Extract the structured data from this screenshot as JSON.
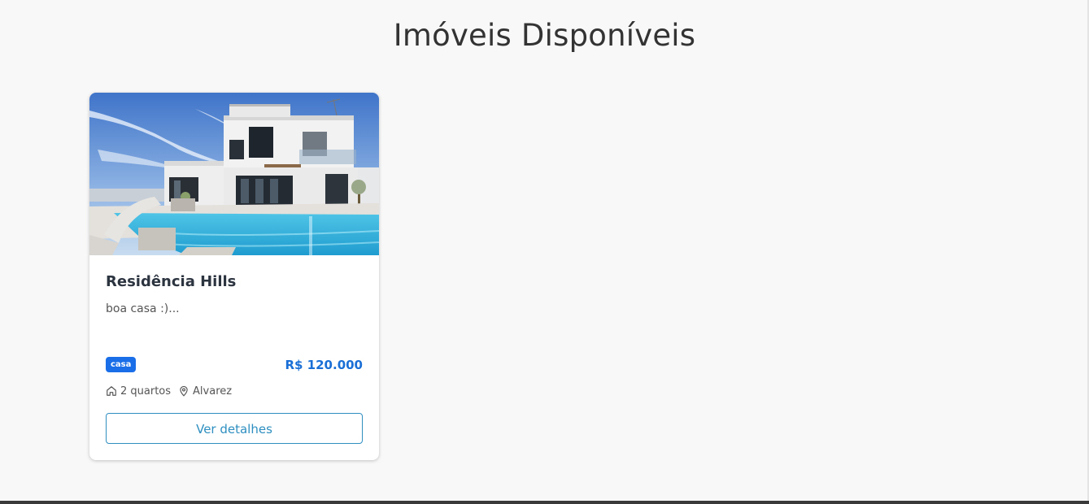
{
  "page": {
    "title": "Imóveis Disponíveis"
  },
  "colors": {
    "background": "#f8f8f8",
    "title": "#333333",
    "badge_bg": "#1a6fe8",
    "price": "#1a6fd6",
    "button_border": "#2e8fc0"
  },
  "listings": [
    {
      "image": "house-with-pool-photo",
      "title": "Residência Hills",
      "description": "boa casa :)...",
      "type_badge": "casa",
      "price": "R$ 120.000",
      "bedrooms": "2 quartos",
      "bedrooms_icon": "home-icon",
      "location": "Alvarez",
      "location_icon": "map-pin-icon",
      "details_label": "Ver detalhes"
    }
  ]
}
